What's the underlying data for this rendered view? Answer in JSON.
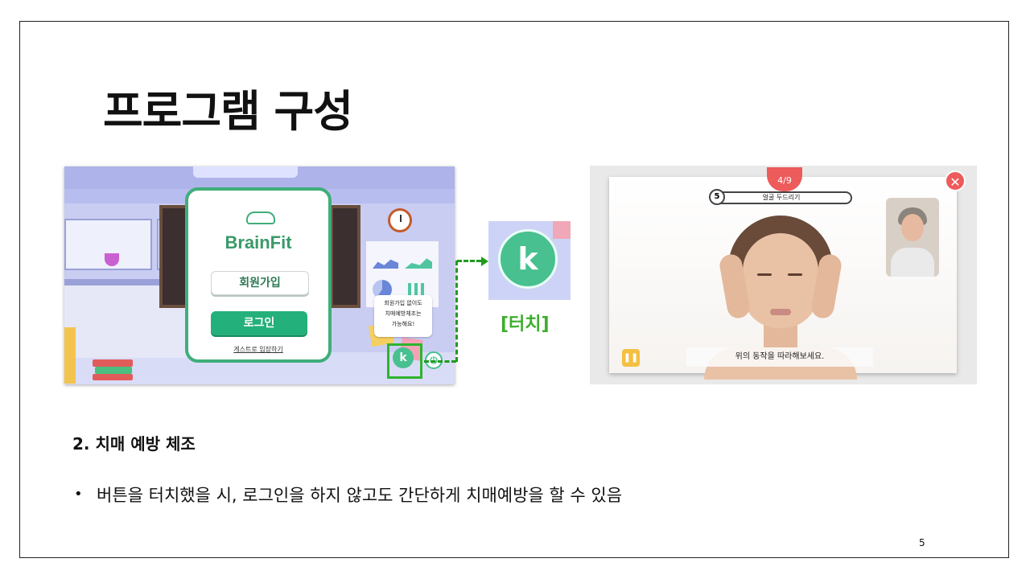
{
  "slide": {
    "title": "프로그램 구성",
    "page_number": "5"
  },
  "lobby_screen": {
    "brand": "BrainFit",
    "signup_label": "회원가입",
    "login_label": "로그인",
    "guest_link": "게스트로 입장하기",
    "tooltip_lines": [
      "회원가입 없이도",
      "치매예방체조는",
      "가능해요!"
    ],
    "exercise_icon_glyph": "k",
    "power_icon_glyph": "⏻"
  },
  "callout": {
    "touch_label": "[터치]",
    "zoom_icon_glyph": "k",
    "accent_color": "#3cae2c"
  },
  "exercise_screen": {
    "progress": "4/9",
    "timer_seconds": "5",
    "exercise_name": "얼굴 두드리기",
    "instruction": "위의 동작을 따라해보세요.",
    "close_glyph": "✕",
    "pause_glyph": "❚❚"
  },
  "section": {
    "heading": "2. 치매 예방 체조",
    "bullet_marker": "•",
    "bullet_text": "버튼을 터치했을 시, 로그인을 하지 않고도 간단하게 치매예방을 할 수 있음"
  },
  "colors": {
    "brand_green": "#24b07a",
    "alert_red": "#ee5b5b",
    "pause_yellow": "#f4c042"
  }
}
